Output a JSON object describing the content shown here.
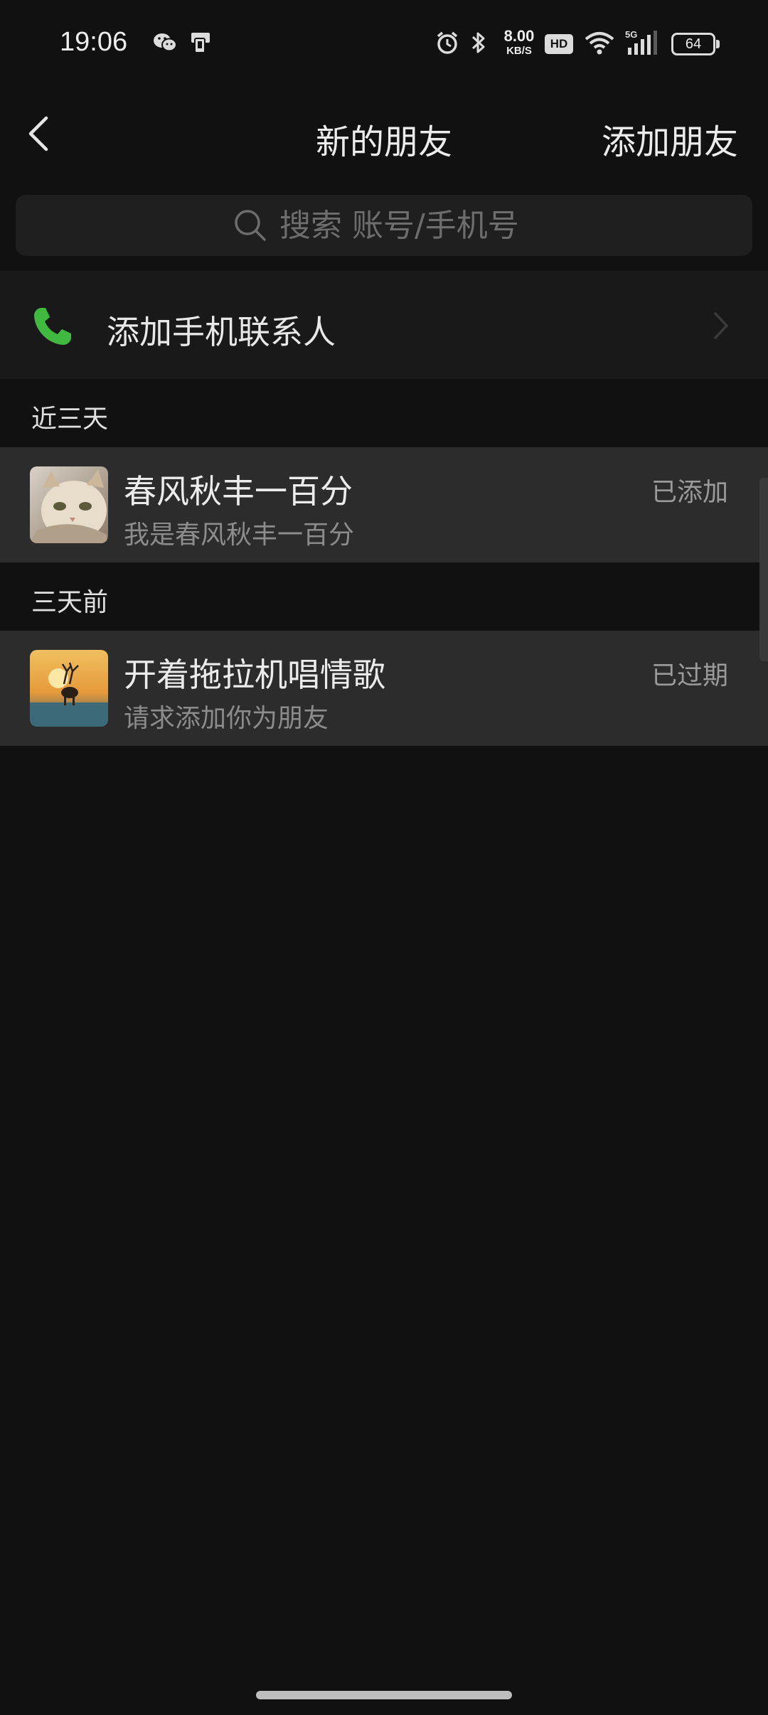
{
  "status_bar": {
    "time": "19:06",
    "net_speed_value": "8.00",
    "net_speed_unit": "KB/S",
    "hd_label": "HD",
    "signal_label": "5G",
    "battery_level": "64",
    "icons": [
      "wechat-icon",
      "device-icon",
      "alarm-icon",
      "bluetooth-icon",
      "wifi-icon",
      "cellular-icon",
      "battery-icon"
    ]
  },
  "nav": {
    "title": "新的朋友",
    "action_label": "添加朋友"
  },
  "search": {
    "placeholder": "搜索 账号/手机号"
  },
  "add_phone_contacts": {
    "label": "添加手机联系人",
    "icon_color": "#3fba3f"
  },
  "sections": [
    {
      "header": "近三天",
      "items": [
        {
          "name": "春风秋丰一百分",
          "message": "我是春风秋丰一百分",
          "status": "已添加",
          "avatar": "cat-photo"
        }
      ]
    },
    {
      "header": "三天前",
      "items": [
        {
          "name": "开着拖拉机唱情歌",
          "message": "请求添加你为朋友",
          "status": "已过期",
          "avatar": "deer-sunset-photo"
        }
      ]
    }
  ]
}
